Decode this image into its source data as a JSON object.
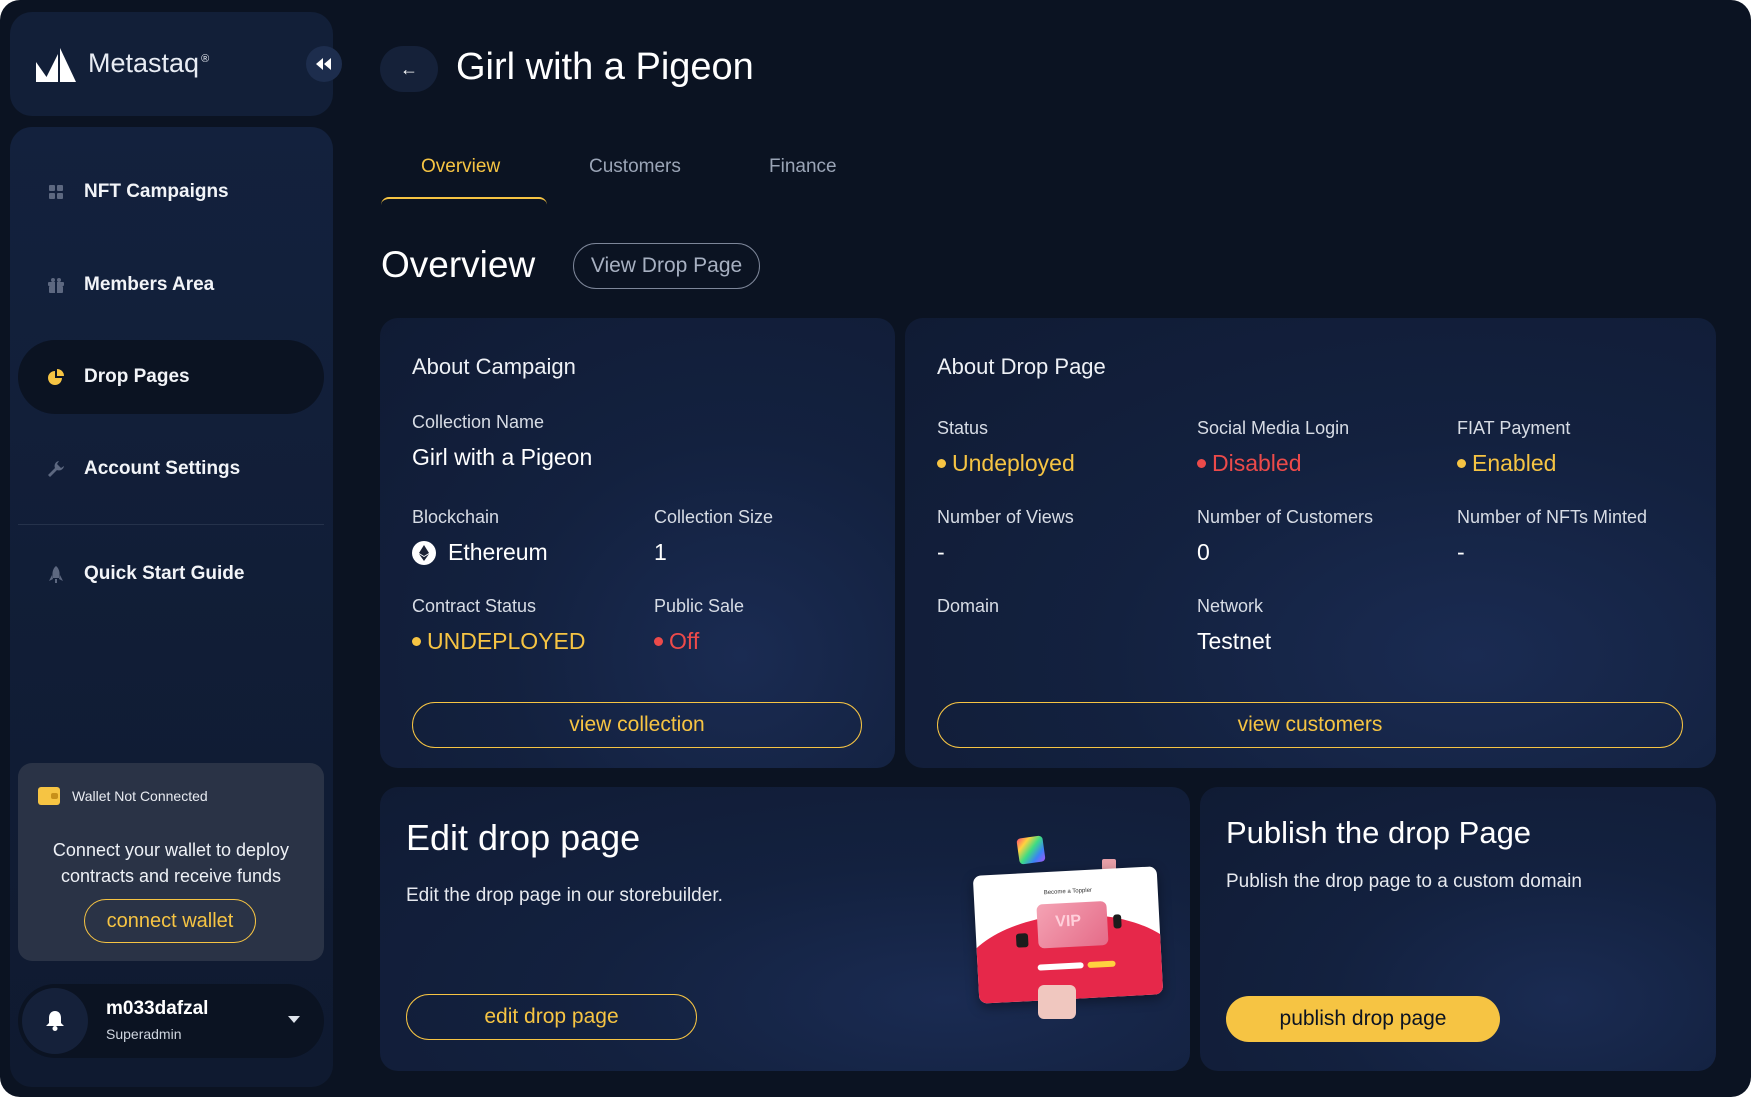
{
  "brand": {
    "name": "Metastaq",
    "mark": "®"
  },
  "sidebar": {
    "items": [
      {
        "label": "NFT Campaigns",
        "icon": "grid-icon"
      },
      {
        "label": "Members Area",
        "icon": "gift-icon"
      },
      {
        "label": "Drop Pages",
        "icon": "pie-chart-icon",
        "active": true
      },
      {
        "label": "Account Settings",
        "icon": "wrench-icon"
      },
      {
        "label": "Quick Start Guide",
        "icon": "rocket-icon"
      }
    ]
  },
  "wallet": {
    "status": "Wallet Not Connected",
    "message": "Connect your wallet to deploy contracts and receive funds",
    "button": "connect wallet"
  },
  "user": {
    "name": "m033dafzal",
    "role": "Superadmin"
  },
  "header": {
    "title": "Girl with a Pigeon"
  },
  "tabs": [
    {
      "label": "Overview",
      "active": true
    },
    {
      "label": "Customers"
    },
    {
      "label": "Finance"
    }
  ],
  "overview": {
    "title": "Overview",
    "view_drop_page": "View Drop Page"
  },
  "campaign": {
    "title": "About Campaign",
    "collection_name_label": "Collection Name",
    "collection_name": "Girl with a Pigeon",
    "blockchain_label": "Blockchain",
    "blockchain": "Ethereum",
    "collection_size_label": "Collection Size",
    "collection_size": "1",
    "contract_status_label": "Contract Status",
    "contract_status": "UNDEPLOYED",
    "public_sale_label": "Public Sale",
    "public_sale": "Off",
    "button": "view collection"
  },
  "drop": {
    "title": "About Drop Page",
    "status_label": "Status",
    "status": "Undeployed",
    "social_label": "Social Media Login",
    "social": "Disabled",
    "fiat_label": "FIAT Payment",
    "fiat": "Enabled",
    "views_label": "Number of Views",
    "views": "-",
    "customers_label": "Number of Customers",
    "customers": "0",
    "minted_label": "Number of NFTs Minted",
    "minted": "-",
    "domain_label": "Domain",
    "network_label": "Network",
    "network": "Testnet",
    "button": "view customers"
  },
  "edit": {
    "title": "Edit drop page",
    "description": "Edit the drop page in our storebuilder.",
    "button": "edit drop page",
    "preview": {
      "banner": "Become a Toppler",
      "badge": "VIP"
    }
  },
  "publish": {
    "title": "Publish the drop Page",
    "description": "Publish the drop page to a custom domain",
    "button": "publish drop page"
  },
  "colors": {
    "accent": "#f6c443",
    "danger": "#ec4a4a",
    "background": "#0b1322",
    "card": "#13213f"
  }
}
